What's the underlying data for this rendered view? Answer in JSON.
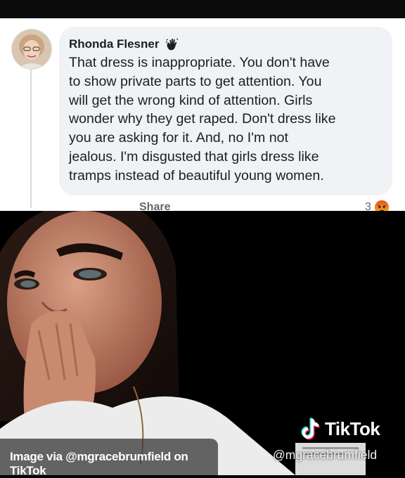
{
  "comment": {
    "author": "Rhonda Flesner",
    "author_badge_icon": "waving-hand-icon",
    "text_lines": [
      "That dress is inappropriate. You don't have",
      "to show private parts to get attention. You",
      "will get the wrong kind of attention. Girls",
      "wonder why they get raped. Don't dress like",
      "you are asking for it. And, no I'm not",
      "jealous. I'm disgusted that girls dress like",
      "tramps instead of beautiful young women."
    ],
    "share_label": "Share",
    "reaction_count": "3",
    "reaction_icon": "angry-reaction-icon"
  },
  "overlay": {
    "tiktok_brand": "TikTok",
    "tiktok_handle": "@mgracebrumfield",
    "credit": "Image via @mgracebrumfield on TikTok"
  },
  "colors": {
    "comment_bg": "#f0f2f5",
    "text": "#1c1e21",
    "muted": "#65676b",
    "tiktok_cyan": "#25f4ee",
    "tiktok_red": "#fe2c55"
  }
}
